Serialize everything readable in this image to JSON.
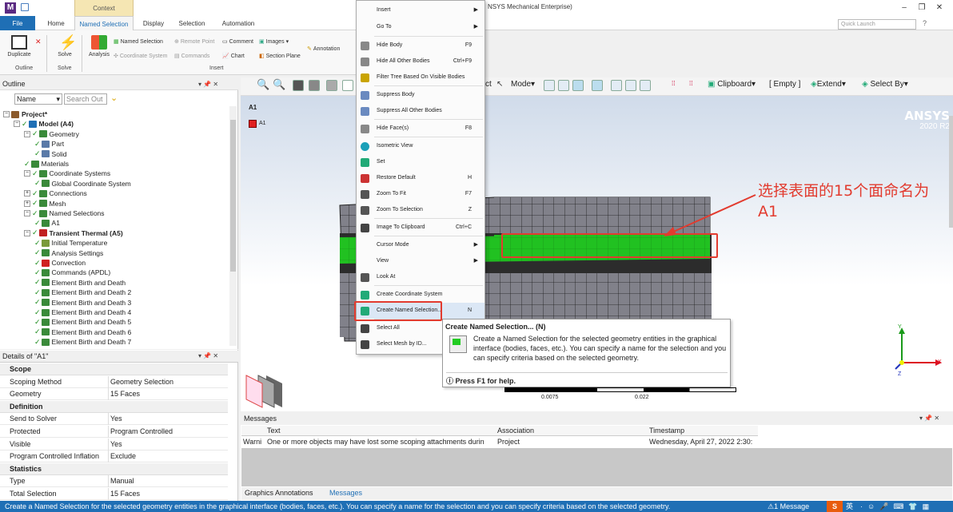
{
  "title_bar": {
    "context_tab": "Context",
    "app_title": "NSYS Mechanical Enterprise)"
  },
  "tabs": [
    "File",
    "Home",
    "Named Selection",
    "Display",
    "Selection",
    "Automation"
  ],
  "quick_launch": "Quick Launch",
  "ribbon": {
    "duplicate": "Duplicate",
    "solve": "Solve",
    "analysis": "Analysis",
    "named_selection": "Named Selection",
    "remote_point": "Remote Point",
    "comment": "Comment",
    "images": "Images",
    "coordinate_system": "Coordinate System",
    "commands": "Commands",
    "chart": "Chart",
    "section_plane": "Section Plane",
    "annotation": "Annotation",
    "groups": [
      "Outline",
      "Solve",
      "Insert"
    ]
  },
  "outline": {
    "title": "Outline",
    "name_filter": "Name",
    "search_placeholder": "Search Out",
    "items": [
      {
        "label": "Project*",
        "level": 0
      },
      {
        "label": "Model (A4)",
        "level": 1
      },
      {
        "label": "Geometry",
        "level": 2
      },
      {
        "label": "Part",
        "level": 3
      },
      {
        "label": "Solid",
        "level": 3
      },
      {
        "label": "Materials",
        "level": 2
      },
      {
        "label": "Coordinate Systems",
        "level": 2
      },
      {
        "label": "Global Coordinate System",
        "level": 3
      },
      {
        "label": "Connections",
        "level": 2
      },
      {
        "label": "Mesh",
        "level": 2
      },
      {
        "label": "Named Selections",
        "level": 2
      },
      {
        "label": "A1",
        "level": 3
      },
      {
        "label": "Transient Thermal (A5)",
        "level": 2
      },
      {
        "label": "Initial Temperature",
        "level": 3
      },
      {
        "label": "Analysis Settings",
        "level": 3
      },
      {
        "label": "Convection",
        "level": 3
      },
      {
        "label": "Commands (APDL)",
        "level": 3
      },
      {
        "label": "Element Birth and Death",
        "level": 3
      },
      {
        "label": "Element Birth and Death 2",
        "level": 3
      },
      {
        "label": "Element Birth and Death 3",
        "level": 3
      },
      {
        "label": "Element Birth and Death 4",
        "level": 3
      },
      {
        "label": "Element Birth and Death 5",
        "level": 3
      },
      {
        "label": "Element Birth and Death 6",
        "level": 3
      },
      {
        "label": "Element Birth and Death 7",
        "level": 3
      }
    ]
  },
  "details": {
    "title": "Details of \"A1\"",
    "sections": [
      {
        "name": "Scope",
        "rows": [
          [
            "Scoping Method",
            "Geometry Selection"
          ],
          [
            "Geometry",
            "15 Faces"
          ]
        ]
      },
      {
        "name": "Definition",
        "rows": [
          [
            "Send to Solver",
            "Yes"
          ],
          [
            "Protected",
            "Program Controlled"
          ],
          [
            "Visible",
            "Yes"
          ],
          [
            "Program Controlled Inflation",
            "Exclude"
          ]
        ]
      },
      {
        "name": "Statistics",
        "rows": [
          [
            "Type",
            "Manual"
          ],
          [
            "Total Selection",
            "15 Faces"
          ]
        ]
      }
    ]
  },
  "graphics": {
    "label": "A1",
    "legend": "A1",
    "brand": "ANSYS",
    "version": "2020 R2",
    "toolbar": {
      "select_partial": "ct",
      "mode": "Mode",
      "clipboard": "Clipboard",
      "empty": "[ Empty ]",
      "extend": "Extend",
      "select_by": "Select By"
    },
    "scale": {
      "a": "0.0075",
      "b": "0.022"
    }
  },
  "context_menu": [
    {
      "label": "Insert",
      "shortcut": "",
      "submenu": true
    },
    {
      "label": "Go To",
      "shortcut": "",
      "submenu": true
    },
    {
      "label": "Hide Body",
      "shortcut": "F9"
    },
    {
      "label": "Hide All Other Bodies",
      "shortcut": "Ctrl+F9"
    },
    {
      "label": "Filter Tree Based On Visible Bodies",
      "shortcut": ""
    },
    {
      "label": "Suppress Body",
      "shortcut": ""
    },
    {
      "label": "Suppress All Other Bodies",
      "shortcut": ""
    },
    {
      "label": "Hide Face(s)",
      "shortcut": "F8"
    },
    {
      "label": "Isometric View",
      "shortcut": ""
    },
    {
      "label": "Set",
      "shortcut": ""
    },
    {
      "label": "Restore Default",
      "shortcut": "H"
    },
    {
      "label": "Zoom To Fit",
      "shortcut": "F7"
    },
    {
      "label": "Zoom To Selection",
      "shortcut": "Z"
    },
    {
      "label": "Image To Clipboard",
      "shortcut": "Ctrl+C"
    },
    {
      "label": "Cursor Mode",
      "shortcut": "",
      "submenu": true
    },
    {
      "label": "View",
      "shortcut": "",
      "submenu": true
    },
    {
      "label": "Look At",
      "shortcut": ""
    },
    {
      "label": "Create Coordinate System",
      "shortcut": ""
    },
    {
      "label": "Create Named Selection...",
      "shortcut": "N"
    },
    {
      "label": "Select All",
      "shortcut": ""
    },
    {
      "label": "Select Mesh by ID...",
      "shortcut": ""
    }
  ],
  "tooltip": {
    "title": "Create Named Selection... (N)",
    "body": "Create a Named Selection for the selected geometry entities in the graphical interface (bodies, faces, etc.). You can specify a name for the selection and you can specify criteria based on the selected geometry.",
    "help": "Press F1 for help."
  },
  "annotation": {
    "line1": "选择表面的15个面命名为",
    "line2": "A1"
  },
  "messages": {
    "title": "Messages",
    "columns": [
      "Text",
      "Association",
      "Timestamp"
    ],
    "row": {
      "type": "Warni",
      "text": "One or more objects may have lost some scoping attachments durin",
      "association": "Project",
      "timestamp": "Wednesday, April 27, 2022 2:30:"
    }
  },
  "bottom_tabs": [
    "Graphics Annotations",
    "Messages"
  ],
  "status": {
    "text": "Create a Named Selection for the selected geometry entities in the graphical interface (bodies, faces, etc.). You can specify a name for the selection and you can specify criteria based on the selected geometry.",
    "messages": "1 Message",
    "ime": "英"
  },
  "colors": {
    "accent": "#1f6fb5",
    "selection": "#22c322",
    "annotation": "#e23b2f",
    "mesh": "#7d7d86"
  }
}
